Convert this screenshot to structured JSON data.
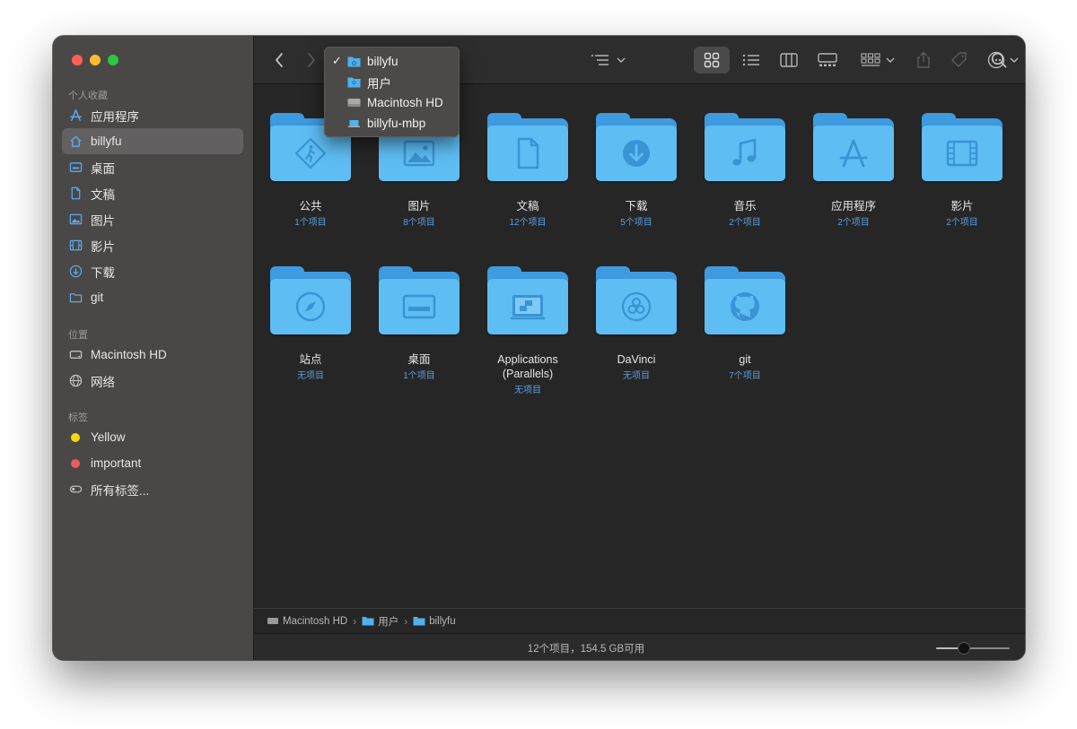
{
  "sidebar": {
    "favorites_header": "个人收藏",
    "favorites": [
      {
        "label": "应用程序",
        "icon": "applications-icon"
      },
      {
        "label": "billyfu",
        "icon": "home-icon"
      },
      {
        "label": "桌面",
        "icon": "desktop-icon"
      },
      {
        "label": "文稿",
        "icon": "document-icon"
      },
      {
        "label": "图片",
        "icon": "picture-icon"
      },
      {
        "label": "影片",
        "icon": "film-icon"
      },
      {
        "label": "下载",
        "icon": "download-icon"
      },
      {
        "label": "git",
        "icon": "folder-icon"
      }
    ],
    "locations_header": "位置",
    "locations": [
      {
        "label": "Macintosh HD",
        "icon": "disk-icon"
      },
      {
        "label": "网络",
        "icon": "network-icon"
      }
    ],
    "tags_header": "标签",
    "tags": [
      {
        "label": "Yellow",
        "color": "#f5d90a"
      },
      {
        "label": "important",
        "color": "#ee5a5a"
      },
      {
        "label": "所有标签...",
        "icon": "all-tags-icon"
      }
    ]
  },
  "menu": {
    "items": [
      {
        "label": "billyfu",
        "checked": true,
        "icon": "home-folder-icon"
      },
      {
        "label": "用户",
        "checked": false,
        "icon": "users-folder-icon"
      },
      {
        "label": "Macintosh HD",
        "checked": false,
        "icon": "disk-icon"
      },
      {
        "label": "billyfu-mbp",
        "checked": false,
        "icon": "laptop-icon"
      }
    ]
  },
  "folders": [
    {
      "name": "公共",
      "count": "1个项目",
      "icon": "public-icon"
    },
    {
      "name": "图片",
      "count": "8个项目",
      "icon": "picture-icon"
    },
    {
      "name": "文稿",
      "count": "12个项目",
      "icon": "document-icon"
    },
    {
      "name": "下载",
      "count": "5个项目",
      "icon": "download-icon"
    },
    {
      "name": "音乐",
      "count": "2个项目",
      "icon": "music-icon"
    },
    {
      "name": "应用程序",
      "count": "2个项目",
      "icon": "applications-icon"
    },
    {
      "name": "影片",
      "count": "2个项目",
      "icon": "film-icon"
    },
    {
      "name": "站点",
      "count": "无项目",
      "icon": "compass-icon"
    },
    {
      "name": "桌面",
      "count": "1个项目",
      "icon": "desktop-icon"
    },
    {
      "name": "Applications\n(Parallels)",
      "count": "无项目",
      "icon": "parallels-icon"
    },
    {
      "name": "DaVinci",
      "count": "无项目",
      "icon": "davinci-icon"
    },
    {
      "name": "git",
      "count": "7个项目",
      "icon": "github-icon"
    }
  ],
  "path": [
    "Macintosh HD",
    "用户",
    "billyfu"
  ],
  "status": "12个项目，154.5 GB可用",
  "zoom_level": 0.38,
  "colors": {
    "folder_front": "#5ebdf3",
    "folder_back": "#3e9be0",
    "accent": "#5b9ee0"
  }
}
